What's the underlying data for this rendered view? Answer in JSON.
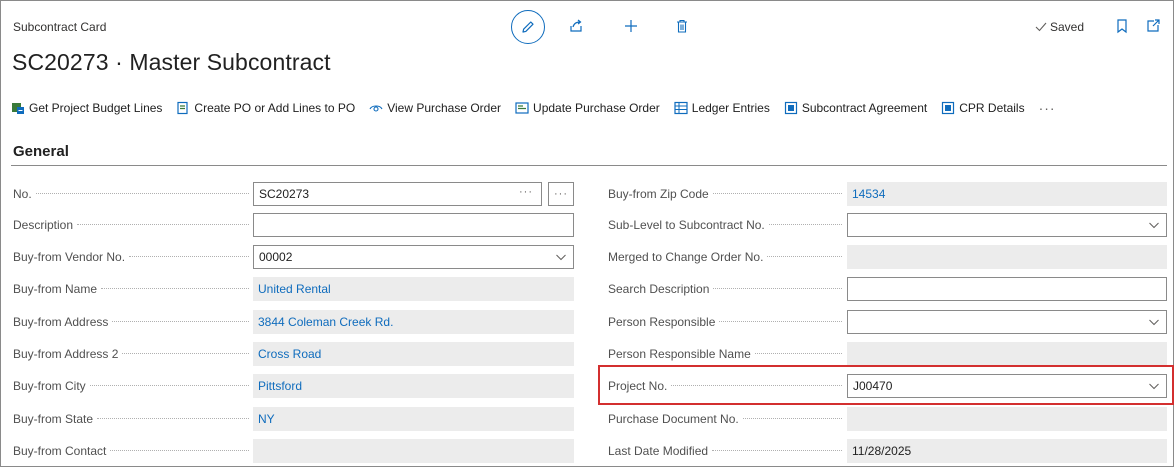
{
  "header": {
    "card_label": "Subcontract Card",
    "title": "SC20273 · Master Subcontract",
    "saved_label": "Saved"
  },
  "actions": [
    {
      "label": "Get Project Budget Lines",
      "icon": "budget-lines-icon"
    },
    {
      "label": "Create PO or Add Lines to PO",
      "icon": "create-po-icon"
    },
    {
      "label": "View Purchase Order",
      "icon": "view-icon"
    },
    {
      "label": "Update Purchase Order",
      "icon": "update-po-icon"
    },
    {
      "label": "Ledger Entries",
      "icon": "ledger-icon"
    },
    {
      "label": "Subcontract Agreement",
      "icon": "report-icon"
    },
    {
      "label": "CPR Details",
      "icon": "report-icon"
    }
  ],
  "more_label": "···",
  "section": {
    "title": "General"
  },
  "left_fields": [
    {
      "label": "No.",
      "value": "SC20273",
      "type": "assist"
    },
    {
      "label": "Description",
      "value": "",
      "type": "input"
    },
    {
      "label": "Buy-from Vendor No.",
      "value": "00002",
      "type": "dropdown"
    },
    {
      "label": "Buy-from Name",
      "value": "United Rental",
      "type": "readonly"
    },
    {
      "label": "Buy-from Address",
      "value": "3844 Coleman Creek Rd.",
      "type": "readonly"
    },
    {
      "label": "Buy-from Address 2",
      "value": "Cross Road",
      "type": "readonly"
    },
    {
      "label": "Buy-from City",
      "value": "Pittsford",
      "type": "readonly"
    },
    {
      "label": "Buy-from State",
      "value": "NY",
      "type": "readonly"
    },
    {
      "label": "Buy-from Contact",
      "value": "",
      "type": "readonly"
    }
  ],
  "right_fields": [
    {
      "label": "Buy-from Zip Code",
      "value": "14534",
      "type": "readonly"
    },
    {
      "label": "Sub-Level to Subcontract No.",
      "value": "",
      "type": "dropdown"
    },
    {
      "label": "Merged to Change Order No.",
      "value": "",
      "type": "readonly"
    },
    {
      "label": "Search Description",
      "value": "",
      "type": "input"
    },
    {
      "label": "Person Responsible",
      "value": "",
      "type": "dropdown"
    },
    {
      "label": "Person Responsible Name",
      "value": "",
      "type": "readonly"
    },
    {
      "label": "Project No.",
      "value": "J00470",
      "type": "dropdown"
    },
    {
      "label": "Purchase Document No.",
      "value": "",
      "type": "readonly"
    },
    {
      "label": "Last Date Modified",
      "value": "11/28/2025",
      "type": "readonly-plain"
    }
  ],
  "colors": {
    "accent": "#0f6cbd",
    "highlight": "#d32f2f",
    "readonly_bg": "#ececec"
  }
}
